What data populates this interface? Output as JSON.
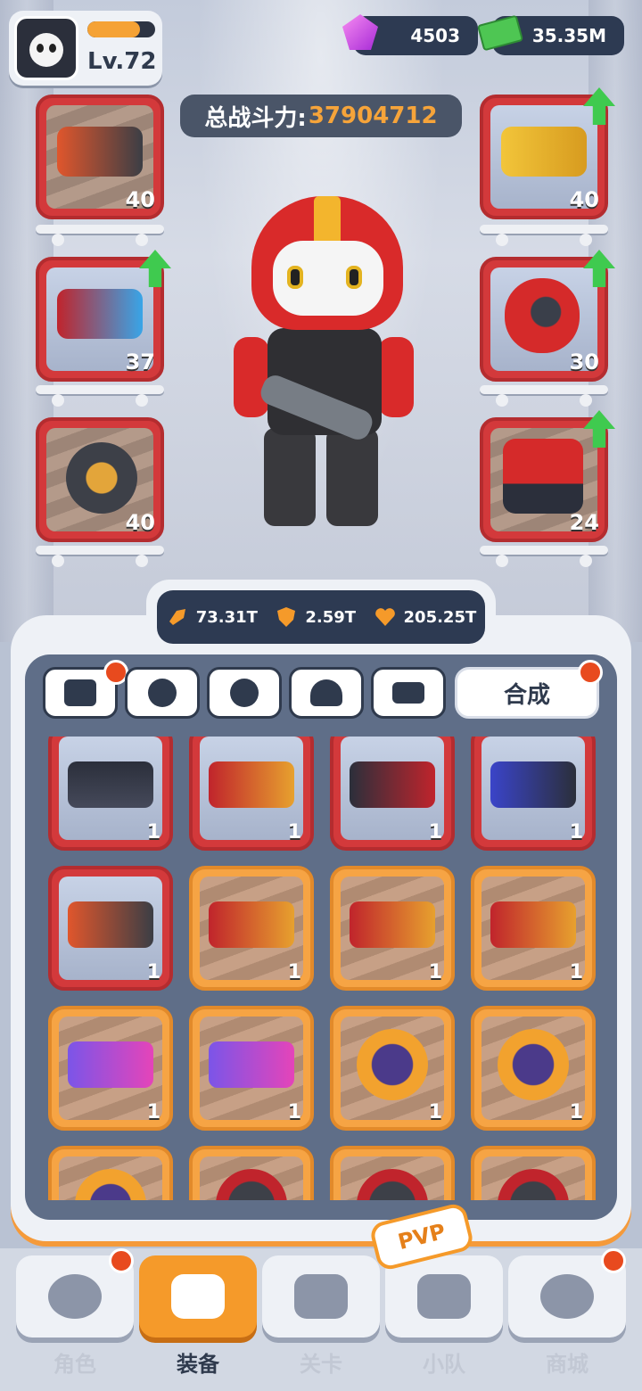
{
  "player": {
    "level": "Lv.72",
    "xp_fraction": 0.78
  },
  "currencies": {
    "gems": "4503",
    "cash": "35.35M"
  },
  "power": {
    "label": "总战斗力:",
    "value": "37904712"
  },
  "equipped_left": [
    {
      "name": "drum-shotgun",
      "level": "40",
      "upgrade": false
    },
    {
      "name": "goggles",
      "level": "37",
      "upgrade": true
    },
    {
      "name": "ammo-drum",
      "level": "40",
      "upgrade": false
    }
  ],
  "equipped_right": [
    {
      "name": "golden-revolver",
      "level": "40",
      "upgrade": true
    },
    {
      "name": "red-helmet",
      "level": "30",
      "upgrade": true
    },
    {
      "name": "red-armor",
      "level": "24",
      "upgrade": true
    }
  ],
  "stats": {
    "attack": "73.31T",
    "defense": "2.59T",
    "health": "205.25T"
  },
  "tabs": {
    "merge_label": "合成"
  },
  "inventory": [
    {
      "icon": "vest-icon",
      "count": "1",
      "rarity": "red"
    },
    {
      "icon": "shotgun-icon",
      "count": "1",
      "rarity": "red"
    },
    {
      "icon": "smg-icon",
      "count": "1",
      "rarity": "red"
    },
    {
      "icon": "sniper-icon",
      "count": "1",
      "rarity": "red"
    },
    {
      "icon": "drum-shotgun-icon",
      "count": "1",
      "rarity": "red"
    },
    {
      "icon": "shotgun-icon",
      "count": "1",
      "rarity": "orange"
    },
    {
      "icon": "shotgun-icon",
      "count": "1",
      "rarity": "orange"
    },
    {
      "icon": "shotgun-icon",
      "count": "1",
      "rarity": "orange"
    },
    {
      "icon": "plasma-rifle-icon",
      "count": "1",
      "rarity": "orange"
    },
    {
      "icon": "plasma-rifle-icon",
      "count": "1",
      "rarity": "orange"
    },
    {
      "icon": "radar-watch-icon",
      "count": "1",
      "rarity": "orange"
    },
    {
      "icon": "radar-watch-icon",
      "count": "1",
      "rarity": "orange"
    },
    {
      "icon": "radar-watch-icon",
      "count": "",
      "rarity": "orange"
    },
    {
      "icon": "ammo-drum-icon",
      "count": "",
      "rarity": "orange"
    },
    {
      "icon": "ammo-drum-icon",
      "count": "",
      "rarity": "orange"
    },
    {
      "icon": "ammo-drum-icon",
      "count": "",
      "rarity": "orange"
    }
  ],
  "nav": {
    "character": "角色",
    "equipment": "装备",
    "stages": "关卡",
    "squad": "小队",
    "shop": "商城",
    "pvp_badge": "PVP"
  },
  "colors": {
    "accent": "#f59a2a",
    "rare_red": "#d3393b",
    "rare_orange": "#f6a444",
    "panel_dark": "#2d3a52"
  }
}
